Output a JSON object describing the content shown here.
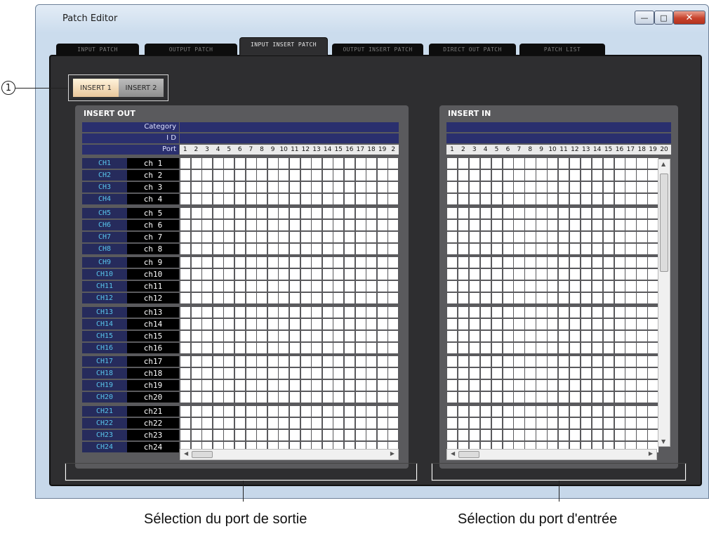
{
  "window": {
    "title": "Patch Editor"
  },
  "tabs": [
    {
      "label": "INPUT PATCH",
      "active": false
    },
    {
      "label": "OUTPUT PATCH",
      "active": false
    },
    {
      "label": "INPUT INSERT PATCH",
      "active": true
    },
    {
      "label": "OUTPUT INSERT PATCH",
      "active": false
    },
    {
      "label": "DIRECT OUT PATCH",
      "active": false
    },
    {
      "label": "PATCH LIST",
      "active": false
    }
  ],
  "insert_selector": {
    "insert1": "INSERT 1",
    "insert2": "INSERT 2",
    "selected": "INSERT 1"
  },
  "callout": {
    "marker": "1"
  },
  "panel_out": {
    "title": "INSERT OUT",
    "header_labels": {
      "category": "Category",
      "id": "I D",
      "port": "Port"
    },
    "port_numbers": [
      "1",
      "2",
      "3",
      "4",
      "5",
      "6",
      "7",
      "8",
      "9",
      "10",
      "11",
      "12",
      "13",
      "14",
      "15",
      "16",
      "17",
      "18",
      "19",
      "2"
    ]
  },
  "panel_in": {
    "title": "INSERT IN",
    "port_numbers": [
      "1",
      "2",
      "3",
      "4",
      "5",
      "6",
      "7",
      "8",
      "9",
      "10",
      "11",
      "12",
      "13",
      "14",
      "15",
      "16",
      "17",
      "18",
      "19",
      "20"
    ]
  },
  "channels": [
    {
      "ch": "CH1",
      "name": "ch 1"
    },
    {
      "ch": "CH2",
      "name": "ch 2"
    },
    {
      "ch": "CH3",
      "name": "ch 3"
    },
    {
      "ch": "CH4",
      "name": "ch 4"
    },
    {
      "ch": "CH5",
      "name": "ch 5"
    },
    {
      "ch": "CH6",
      "name": "ch 6"
    },
    {
      "ch": "CH7",
      "name": "ch 7"
    },
    {
      "ch": "CH8",
      "name": "ch 8"
    },
    {
      "ch": "CH9",
      "name": "ch 9"
    },
    {
      "ch": "CH10",
      "name": "ch10"
    },
    {
      "ch": "CH11",
      "name": "ch11"
    },
    {
      "ch": "CH12",
      "name": "ch12"
    },
    {
      "ch": "CH13",
      "name": "ch13"
    },
    {
      "ch": "CH14",
      "name": "ch14"
    },
    {
      "ch": "CH15",
      "name": "ch15"
    },
    {
      "ch": "CH16",
      "name": "ch16"
    },
    {
      "ch": "CH17",
      "name": "ch17"
    },
    {
      "ch": "CH18",
      "name": "ch18"
    },
    {
      "ch": "CH19",
      "name": "ch19"
    },
    {
      "ch": "CH20",
      "name": "ch20"
    },
    {
      "ch": "CH21",
      "name": "ch21"
    },
    {
      "ch": "CH22",
      "name": "ch22"
    },
    {
      "ch": "CH23",
      "name": "ch23"
    },
    {
      "ch": "CH24",
      "name": "ch24"
    }
  ],
  "captions": {
    "output": "Sélection du port de sortie",
    "input": "Sélection du port d'entrée"
  }
}
